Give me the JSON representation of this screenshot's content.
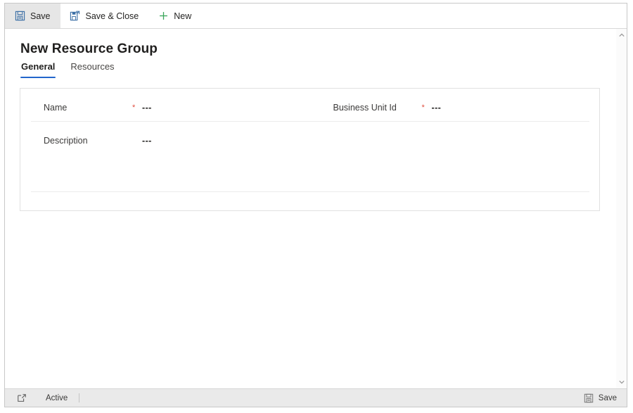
{
  "window": {
    "title": "New Resource Group"
  },
  "command_bar": {
    "items": [
      {
        "label": "Save",
        "icon": "save-floppy-icon",
        "active": true
      },
      {
        "label": "Save & Close",
        "icon": "save-and-close-icon",
        "active": false
      },
      {
        "label": "New",
        "icon": "plus-icon",
        "active": false
      }
    ]
  },
  "tabs": [
    {
      "label": "General",
      "selected": true
    },
    {
      "label": "Resources",
      "selected": false
    }
  ],
  "form": {
    "left_column": [
      {
        "label": "Name",
        "required": true,
        "value": "---"
      },
      {
        "label": "Description",
        "required": false,
        "value": "---"
      }
    ],
    "right_column": [
      {
        "label": "Business Unit Id",
        "required": true,
        "value": "---"
      }
    ],
    "required_marker": "*"
  },
  "scrollbar": {
    "up_arrow": "chevron-up-icon",
    "down_arrow": "chevron-down-icon"
  },
  "status_bar": {
    "popout_icon": "open-in-new-window-icon",
    "state_label": "Active",
    "save_label": "Save",
    "save_icon": "save-floppy-icon"
  },
  "colors": {
    "accent_blue": "#2266cc",
    "required_red": "#e04c3d",
    "new_green": "#3aa65a",
    "icon_blue": "#3a6ea5",
    "border": "#e1e1e1",
    "status_bg": "#eaeaea"
  }
}
